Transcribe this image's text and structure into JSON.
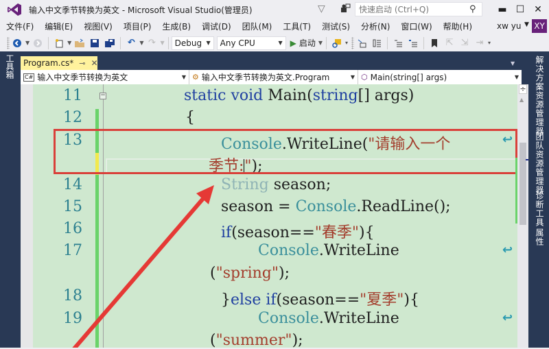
{
  "window": {
    "title": "输入中文季节转换为英文 - Microsoft Visual Studio(管理员)",
    "quick_launch_placeholder": "快速启动 (Ctrl+Q)",
    "controls": {
      "minimize": "▬",
      "maximize": "☐",
      "close": "✕"
    }
  },
  "menu": {
    "items": [
      "文件(F)",
      "编辑(E)",
      "视图(V)",
      "项目(P)",
      "生成(B)",
      "调试(D)",
      "团队(M)",
      "工具(T)",
      "测试(S)",
      "分析(N)",
      "窗口(W)",
      "帮助(H)"
    ],
    "user_name": "xw yu",
    "avatar_initials": "XY",
    "accent_color": "#68217a"
  },
  "toolbar": {
    "config": "Debug",
    "platform": "Any CPU",
    "start_label": "启动"
  },
  "side_tabs": {
    "left": "工具箱",
    "right": [
      "解决方案资源管理器",
      "团队资源管理器",
      "诊断工具",
      "属性"
    ]
  },
  "document_tab": {
    "label": "Program.cs*",
    "pin_glyph": "⊸",
    "close_glyph": "✕"
  },
  "navigation": {
    "project": "输入中文季节转换为英文",
    "class": "输入中文季节转换为英文.Program",
    "member": "Main(string[] args)"
  },
  "editor": {
    "line_numbers": [
      "11",
      "12",
      "13",
      "14",
      "15",
      "16",
      "17",
      "18",
      "19"
    ],
    "lines": {
      "l11": {
        "kw1": "static",
        "kw2": "void",
        "name": "Main(",
        "kw3": "string",
        "rest": "[] args)"
      },
      "l12": {
        "text": "{"
      },
      "l13a": {
        "type": "Console",
        "method": ".WriteLine(",
        "str": "\"请输入一个"
      },
      "l13b": {
        "str": "季节:",
        "str_end": "\"",
        "rest": ");"
      },
      "l14": {
        "type": "String",
        "rest": " season;"
      },
      "l15": {
        "pre": "season = ",
        "type": "Console",
        "rest": ".ReadLine();"
      },
      "l16": {
        "kw": "if",
        "pre": "(season==",
        "str": "\"春季\"",
        "rest": "){"
      },
      "l17a": {
        "type": "Console",
        "rest": ".WriteLine"
      },
      "l17b": {
        "pre": "(",
        "str": "\"spring\"",
        "rest": ");"
      },
      "l18": {
        "pre": "}",
        "kw1": "else",
        "kw2": " if",
        "mid": "(season==",
        "str": "\"夏季\"",
        "rest": "){"
      },
      "l19a": {
        "type": "Console",
        "rest": ".WriteLine"
      },
      "l19b": {
        "pre": "(",
        "str": "\"summer\"",
        "rest": ");"
      }
    },
    "collapse_glyph": "−",
    "wrap_glyph": "↩"
  },
  "annotation": {
    "highlight_color": "#d9403a"
  }
}
